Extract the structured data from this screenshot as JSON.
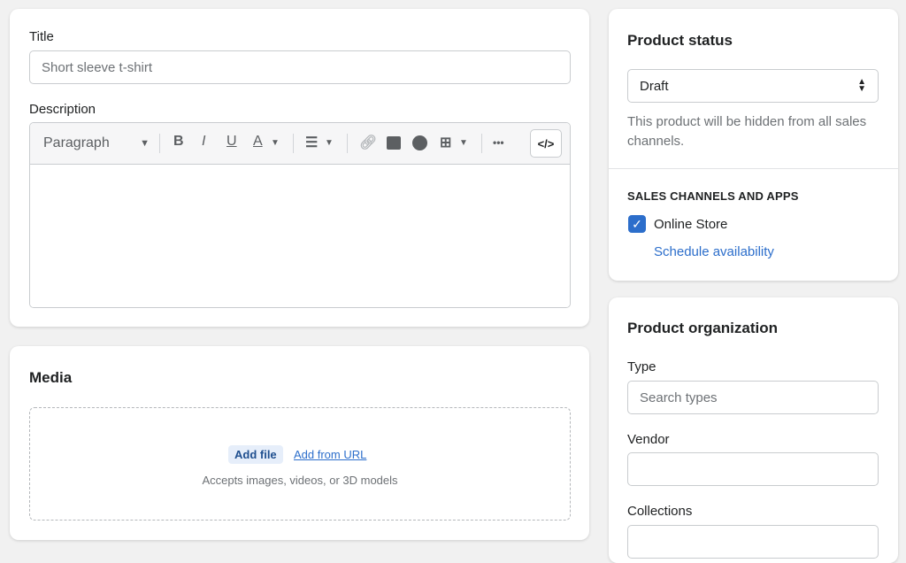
{
  "title_field": {
    "label": "Title",
    "value": "Short sleeve t-shirt"
  },
  "description": {
    "label": "Description",
    "format": "Paragraph"
  },
  "toolbar": {
    "bold": "B",
    "italic": "I",
    "underline": "U",
    "color": "A",
    "more": "•••",
    "code": "</>"
  },
  "media": {
    "title": "Media",
    "add_file": "Add file",
    "add_url": "Add from URL",
    "hint": "Accepts images, videos, or 3D models"
  },
  "status": {
    "title": "Product status",
    "value": "Draft",
    "help": "This product will be hidden from all sales channels.",
    "channels_heading": "SALES CHANNELS AND APPS",
    "channel": "Online Store",
    "channel_checked": true,
    "schedule": "Schedule availability"
  },
  "organization": {
    "title": "Product organization",
    "type_label": "Type",
    "type_placeholder": "Search types",
    "vendor_label": "Vendor",
    "collections_label": "Collections"
  },
  "colors": {
    "accent": "#2c6ecb",
    "checkbox": "#2c6ecb"
  }
}
